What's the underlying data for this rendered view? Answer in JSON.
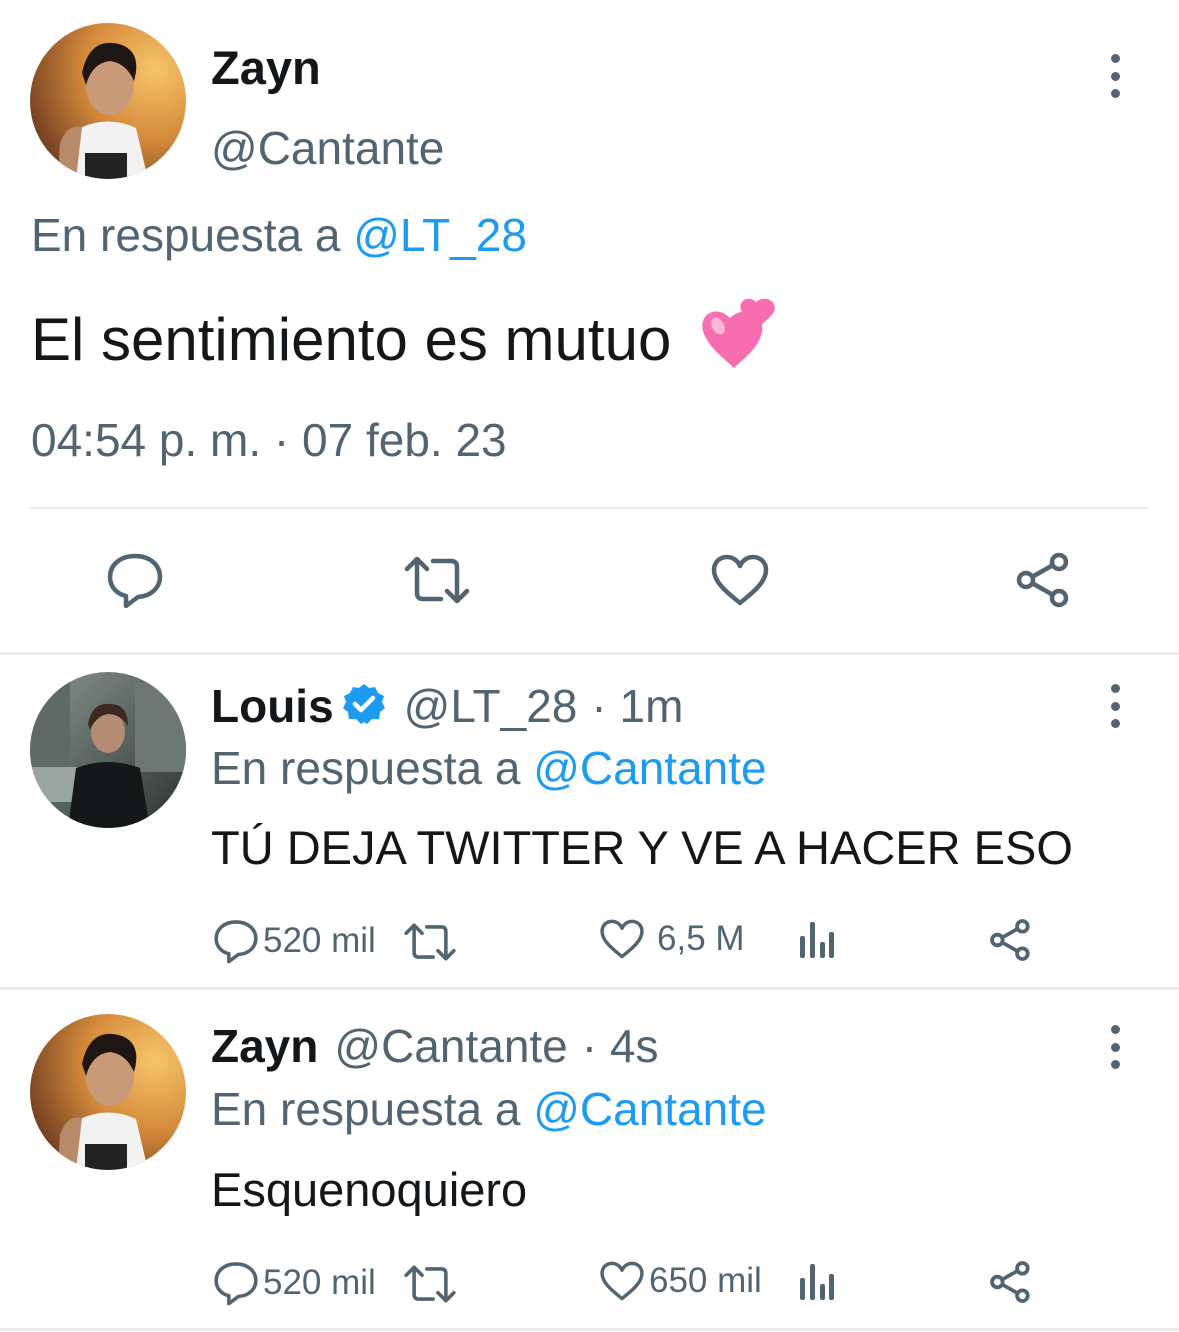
{
  "main_tweet": {
    "name": "Zayn",
    "handle": "@Cantante",
    "reply_prefix": "En respuesta a",
    "reply_to": "@LT_28",
    "text": "El sentimiento es mutuo",
    "emoji": "💕",
    "timestamp": "04:54 p. m. · 07 feb. 23",
    "actions": [
      "reply-icon",
      "retweet-icon",
      "like-icon",
      "share-icon"
    ]
  },
  "replies": [
    {
      "name": "Louis",
      "verified": true,
      "handle": "@LT_28",
      "time": "· 1m",
      "reply_prefix": "En respuesta a",
      "reply_to": "@Cantante",
      "text": "TÚ DEJA TWITTER Y VE A HACER ESO",
      "reply_count": "520 mil",
      "like_count": "6,5 M"
    },
    {
      "name": "Zayn",
      "verified": false,
      "handle": "@Cantante",
      "time": "· 4s",
      "reply_prefix": "En respuesta a",
      "reply_to": "@Cantante",
      "text": "Esquenoquiero",
      "reply_count": "520 mil",
      "like_count": "650 mil"
    }
  ],
  "colors": {
    "accent": "#1d9bf0",
    "secondary_text": "#536471",
    "divider": "#e6ecf0"
  }
}
